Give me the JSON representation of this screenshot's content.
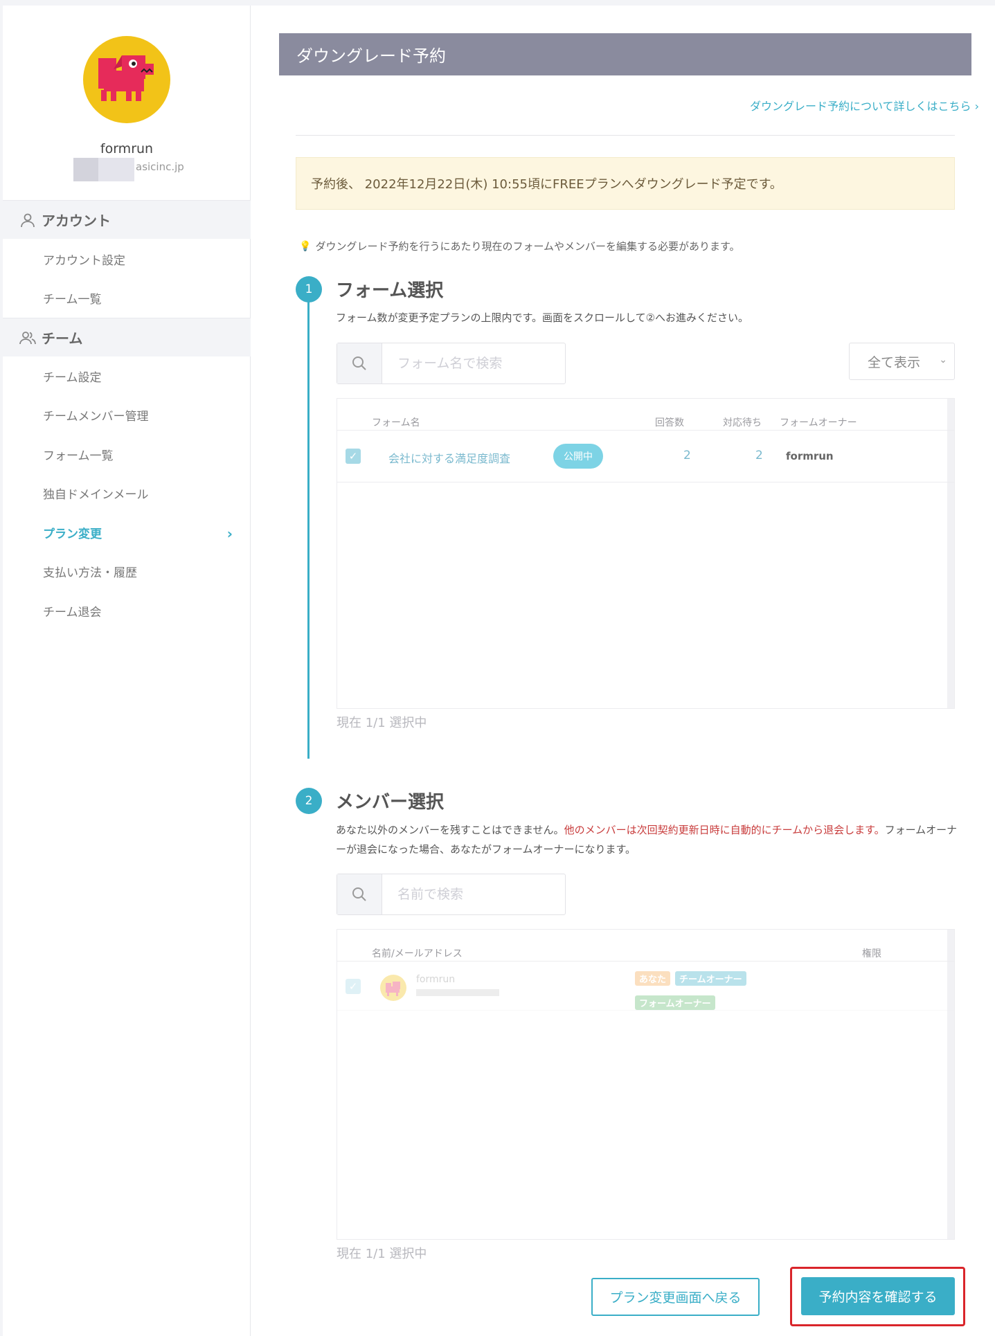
{
  "sidebar": {
    "team_name": "formrun",
    "team_email": "asicinc.jp",
    "account_section": "アカウント",
    "account_items": [
      "アカウント設定",
      "チーム一覧"
    ],
    "team_section": "チーム",
    "team_items": [
      "チーム設定",
      "チームメンバー管理",
      "フォーム一覧",
      "独自ドメインメール",
      "プラン変更",
      "支払い方法・履歴",
      "チーム退会"
    ],
    "active_item": "プラン変更"
  },
  "page": {
    "title": "ダウングレード予約",
    "help_link": "ダウングレード予約について詳しくはこちら",
    "notice": "予約後、 2022年12月22日(木) 10:55頃にFREEプランへダウングレード予定です。",
    "tip": "ダウングレード予約を行うにあたり現在のフォームやメンバーを編集する必要があります。"
  },
  "step1": {
    "number": "1",
    "title": "フォーム選択",
    "desc": "フォーム数が変更予定プランの上限内です。画面をスクロールして②へお進みください。",
    "search_placeholder": "フォーム名で検索",
    "filter_value": "全て表示",
    "columns": {
      "name": "フォーム名",
      "answers": "回答数",
      "pending": "対応待ち",
      "owner": "フォームオーナー"
    },
    "rows": [
      {
        "name": "会社に対する満足度調査",
        "status": "公開中",
        "answers": "2",
        "pending": "2",
        "owner": "formrun"
      }
    ],
    "selected": "現在 1/1 選択中"
  },
  "step2": {
    "number": "2",
    "title": "メンバー選択",
    "desc_plain": "あなた以外のメンバーを残すことはできません。",
    "desc_red": "他のメンバーは次回契約更新日時に自動的にチームから退会します。",
    "desc_rest": "フォームオーナーが退会になった場合、あなたがフォームオーナーになります。",
    "search_placeholder": "名前で検索",
    "columns": {
      "name": "名前/メールアドレス",
      "role": "権限"
    },
    "rows": [
      {
        "name": "formrun",
        "tags": [
          "あなた",
          "チームオーナー",
          "フォームオーナー"
        ]
      }
    ],
    "selected": "現在 1/1 選択中"
  },
  "actions": {
    "back": "プラン変更画面へ戻る",
    "confirm": "予約内容を確認する"
  },
  "colors": {
    "accent": "#3aaec7",
    "title_bar": "#8a8b9e",
    "highlight": "#d9252a"
  }
}
